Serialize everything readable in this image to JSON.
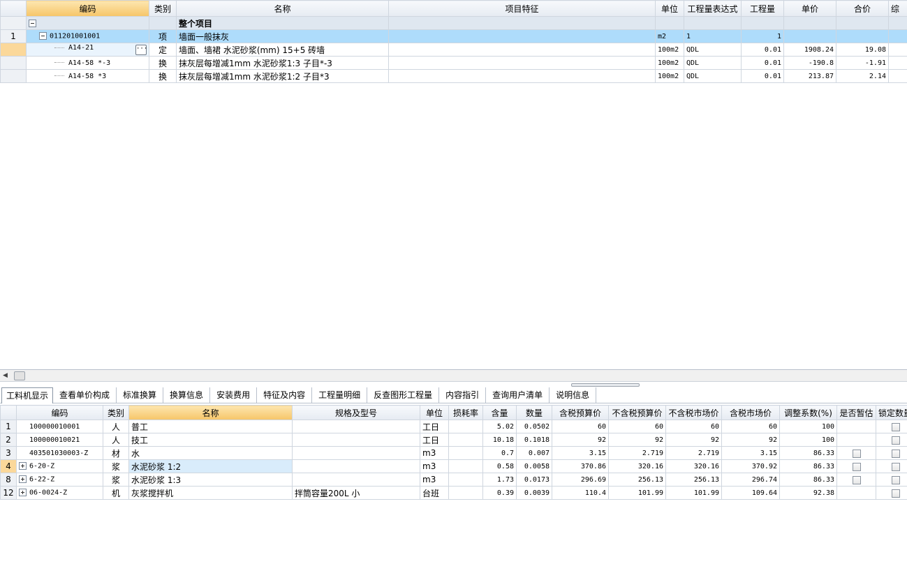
{
  "top_grid": {
    "headers": [
      "编码",
      "类别",
      "名称",
      "项目特征",
      "单位",
      "工程量表达式",
      "工程量",
      "单价",
      "合价",
      "综"
    ],
    "whole_project_label": "整个项目",
    "rows": [
      {
        "index": "1",
        "code": "011201001001",
        "type": "项",
        "name": "墙面一般抹灰",
        "feature": "",
        "unit": "m2",
        "expr": "1",
        "qty": "1",
        "price": "",
        "total": ""
      },
      {
        "index": "",
        "code": "A14-21",
        "type": "定",
        "name": "墙面、墙裙 水泥砂浆(mm) 15+5 砖墙",
        "feature": "",
        "unit": "100m2",
        "expr": "QDL",
        "qty": "0.01",
        "price": "1908.24",
        "total": "19.08"
      },
      {
        "index": "",
        "code": "A14-58 *-3",
        "type": "换",
        "name": "抹灰层每增减1mm 水泥砂浆1:3 子目*-3",
        "feature": "",
        "unit": "100m2",
        "expr": "QDL",
        "qty": "0.01",
        "price": "-190.8",
        "total": "-1.91"
      },
      {
        "index": "",
        "code": "A14-58 *3",
        "type": "换",
        "name": "抹灰层每增减1mm 水泥砂浆1:2 子目*3",
        "feature": "",
        "unit": "100m2",
        "expr": "QDL",
        "qty": "0.01",
        "price": "213.87",
        "total": "2.14"
      }
    ]
  },
  "tabs": [
    "工料机显示",
    "查看单价构成",
    "标准换算",
    "换算信息",
    "安装费用",
    "特征及内容",
    "工程量明细",
    "反查图形工程量",
    "内容指引",
    "查询用户清单",
    "说明信息"
  ],
  "bottom_grid": {
    "headers": [
      "编码",
      "类别",
      "名称",
      "规格及型号",
      "单位",
      "损耗率",
      "含量",
      "数量",
      "含税预算价",
      "不含税预算价",
      "不含税市场价",
      "含税市场价",
      "调整系数(%)",
      "是否暂估",
      "锁定数量"
    ],
    "rows": [
      {
        "index": "1",
        "code": "100000010001",
        "type": "人",
        "name": "普工",
        "spec": "",
        "unit": "工日",
        "loss": "",
        "content": "5.02",
        "qty": "0.0502",
        "tax_budget": "60",
        "notax_budget": "60",
        "notax_market": "60",
        "tax_market": "60",
        "coef": "100",
        "expand": false,
        "estimate_chk": false,
        "lock_chk": true
      },
      {
        "index": "2",
        "code": "100000010021",
        "type": "人",
        "name": "技工",
        "spec": "",
        "unit": "工日",
        "loss": "",
        "content": "10.18",
        "qty": "0.1018",
        "tax_budget": "92",
        "notax_budget": "92",
        "notax_market": "92",
        "tax_market": "92",
        "coef": "100",
        "expand": false,
        "estimate_chk": false,
        "lock_chk": true
      },
      {
        "index": "3",
        "code": "403501030003-Z",
        "type": "材",
        "name": "水",
        "spec": "",
        "unit": "m3",
        "loss": "",
        "content": "0.7",
        "qty": "0.007",
        "tax_budget": "3.15",
        "notax_budget": "2.719",
        "notax_market": "2.719",
        "tax_market": "3.15",
        "coef": "86.33",
        "expand": false,
        "estimate_chk": true,
        "lock_chk": true
      },
      {
        "index": "4",
        "code": "6-20-Z",
        "type": "浆",
        "name": "水泥砂浆 1:2",
        "spec": "",
        "unit": "m3",
        "loss": "",
        "content": "0.58",
        "qty": "0.0058",
        "tax_budget": "370.86",
        "notax_budget": "320.16",
        "notax_market": "320.16",
        "tax_market": "370.92",
        "coef": "86.33",
        "expand": true,
        "estimate_chk": true,
        "lock_chk": true
      },
      {
        "index": "8",
        "code": "6-22-Z",
        "type": "浆",
        "name": "水泥砂浆 1:3",
        "spec": "",
        "unit": "m3",
        "loss": "",
        "content": "1.73",
        "qty": "0.0173",
        "tax_budget": "296.69",
        "notax_budget": "256.13",
        "notax_market": "256.13",
        "tax_market": "296.74",
        "coef": "86.33",
        "expand": true,
        "estimate_chk": true,
        "lock_chk": true
      },
      {
        "index": "12",
        "code": "06-0024-Z",
        "type": "机",
        "name": "灰浆搅拌机",
        "spec": "拌筒容量200L 小",
        "unit": "台班",
        "loss": "",
        "content": "0.39",
        "qty": "0.0039",
        "tax_budget": "110.4",
        "notax_budget": "101.99",
        "notax_market": "101.99",
        "tax_market": "109.64",
        "coef": "92.38",
        "expand": true,
        "estimate_chk": false,
        "lock_chk": true
      }
    ]
  },
  "icons": {
    "ellipsis": "ellipsis-icon",
    "scroll_left": "arrow-left-icon"
  },
  "colors": {
    "header_sorted": "#f6c568",
    "selected_row": "#aedcfb",
    "whole_row": "#dfe7f0"
  }
}
